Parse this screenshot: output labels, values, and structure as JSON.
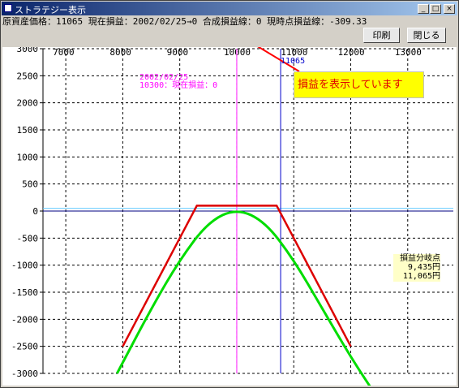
{
  "window": {
    "title": "ストラテジー表示",
    "min_label": "_",
    "max_label": "□",
    "close_label": "×"
  },
  "info": {
    "text": "原資産価格：11065 現在損益：2002/02/25→0 合成損益線：0 現時点損益線：-309.33"
  },
  "buttons": {
    "print": "印刷",
    "close": "閉じる"
  },
  "callout": "損益を表示しています",
  "date_label": {
    "date": "2002/02/25",
    "value": "10300：現在損益：0"
  },
  "strike_label": "11065",
  "breakeven": {
    "title": "損益分岐点",
    "low": "9,435円",
    "high": "11,065円"
  },
  "colors": {
    "payoff_at_expiry": "#dd0000",
    "payoff_now": "#00dd00",
    "date_line": "#ff66ff",
    "price_line": "#0000cc",
    "zero_line": "#66ccff",
    "callout_bg": "#ffff00"
  },
  "chart_data": {
    "type": "line",
    "x_ticks": [
      7000,
      8000,
      9000,
      10000,
      11000,
      12000,
      13000
    ],
    "y_ticks": [
      3000,
      2500,
      2000,
      1500,
      1000,
      500,
      0,
      -500,
      -1000,
      -1500,
      -2000,
      -2500,
      -3000
    ],
    "xlim": [
      6600,
      13800
    ],
    "ylim": [
      -3000,
      3000
    ],
    "grid": true,
    "series": [
      {
        "x": [
          8000,
          9300,
          10000,
          10700,
          12000
        ],
        "y": [
          -2500,
          100,
          100,
          100,
          -2500
        ]
      },
      {
        "x": [
          7900,
          8500,
          9000,
          9500,
          10000,
          10500,
          11000,
          11500,
          12000,
          12500
        ],
        "y": [
          -3000,
          -1800,
          -900,
          -200,
          50,
          -200,
          -900,
          -1800,
          -2700,
          -3500
        ]
      }
    ],
    "vlines": [
      10000,
      10770
    ],
    "hline": 50
  }
}
